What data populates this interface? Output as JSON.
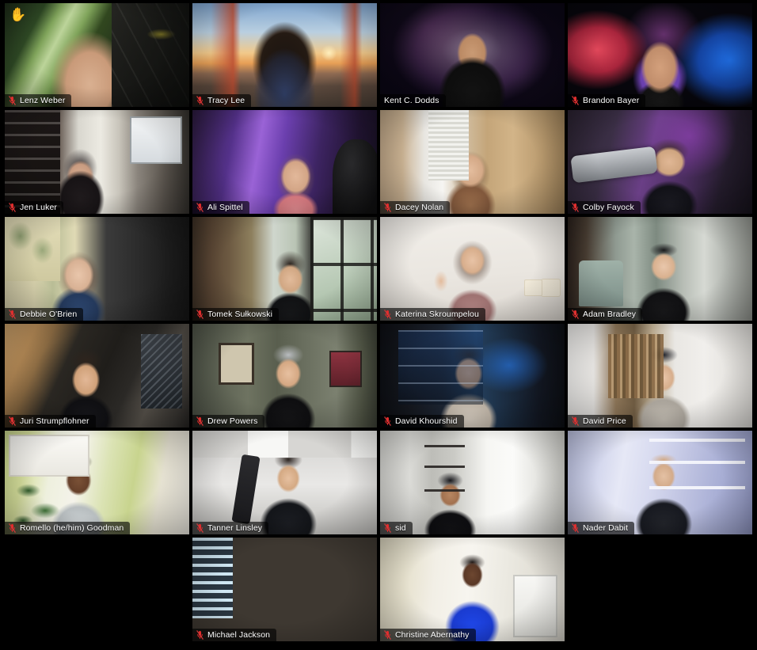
{
  "app": {
    "type": "video-conference-gallery",
    "background_color": "#000000",
    "active_speaker_border_color": "#e9e9a6",
    "name_tag_background": "rgba(0,0,0,0.62)",
    "name_tag_text_color": "#ffffff",
    "mic_muted_color": "#e02b2b",
    "raised_hand_glyph": "✋",
    "raised_hand_color": "#f5c342"
  },
  "grid": {
    "columns": 4,
    "rows": 6,
    "total_participants": 22
  },
  "rows": [
    {
      "tiles": [
        {
          "name": "Lenz Weber",
          "muted": true,
          "active_speaker": false,
          "hand_raised": true,
          "bg": "bg-lenz"
        },
        {
          "name": "Tracy Lee",
          "muted": true,
          "active_speaker": false,
          "hand_raised": false,
          "bg": "bg-tracy"
        },
        {
          "name": "Kent C. Dodds",
          "muted": false,
          "active_speaker": true,
          "hand_raised": false,
          "bg": "bg-kent"
        },
        {
          "name": "Brandon Bayer",
          "muted": true,
          "active_speaker": false,
          "hand_raised": false,
          "bg": "bg-brandon"
        }
      ]
    },
    {
      "tiles": [
        {
          "name": "Jen Luker",
          "muted": true,
          "active_speaker": false,
          "hand_raised": false,
          "bg": "bg-jen"
        },
        {
          "name": "Ali Spittel",
          "muted": true,
          "active_speaker": false,
          "hand_raised": false,
          "bg": "bg-ali"
        },
        {
          "name": "Dacey Nolan",
          "muted": true,
          "active_speaker": false,
          "hand_raised": false,
          "bg": "bg-dacey"
        },
        {
          "name": "Colby Fayock",
          "muted": true,
          "active_speaker": false,
          "hand_raised": false,
          "bg": "bg-colby"
        }
      ]
    },
    {
      "tiles": [
        {
          "name": "Debbie O'Brien",
          "muted": true,
          "active_speaker": false,
          "hand_raised": false,
          "bg": "bg-debbie"
        },
        {
          "name": "Tomek Sułkowski",
          "muted": true,
          "active_speaker": false,
          "hand_raised": false,
          "bg": "bg-tomek"
        },
        {
          "name": "Katerina Skroumpelou",
          "muted": true,
          "active_speaker": false,
          "hand_raised": false,
          "bg": "bg-katerina"
        },
        {
          "name": "Adam Bradley",
          "muted": true,
          "active_speaker": false,
          "hand_raised": false,
          "bg": "bg-adam"
        }
      ]
    },
    {
      "tiles": [
        {
          "name": "Juri Strumpflohner",
          "muted": true,
          "active_speaker": false,
          "hand_raised": false,
          "bg": "bg-juri"
        },
        {
          "name": "Drew Powers",
          "muted": true,
          "active_speaker": false,
          "hand_raised": false,
          "bg": "bg-drew"
        },
        {
          "name": "David Khourshid",
          "muted": true,
          "active_speaker": false,
          "hand_raised": false,
          "bg": "bg-david-k"
        },
        {
          "name": "David Price",
          "muted": true,
          "active_speaker": false,
          "hand_raised": false,
          "bg": "bg-david-p"
        }
      ]
    },
    {
      "tiles": [
        {
          "name": "Romello (he/him) Goodman",
          "muted": true,
          "active_speaker": false,
          "hand_raised": false,
          "bg": "bg-romello"
        },
        {
          "name": "Tanner Linsley",
          "muted": true,
          "active_speaker": false,
          "hand_raised": false,
          "bg": "bg-tanner"
        },
        {
          "name": "sid",
          "muted": true,
          "active_speaker": false,
          "hand_raised": false,
          "bg": "bg-sid"
        },
        {
          "name": "Nader Dabit",
          "muted": true,
          "active_speaker": false,
          "hand_raised": false,
          "bg": "bg-nader"
        }
      ]
    },
    {
      "tiles": [
        {
          "name": "Michael Jackson",
          "muted": true,
          "active_speaker": false,
          "hand_raised": false,
          "bg": "bg-michael"
        },
        {
          "name": "Christine Abernathy",
          "muted": true,
          "active_speaker": false,
          "hand_raised": false,
          "bg": "bg-christine"
        }
      ]
    }
  ]
}
